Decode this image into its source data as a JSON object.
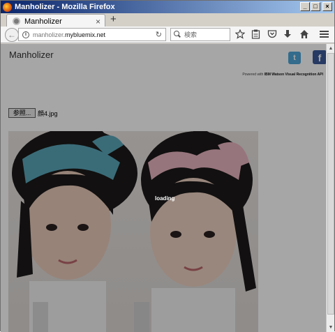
{
  "window": {
    "title": "Manholizer - Mozilla Firefox",
    "controls": {
      "minimize": "_",
      "maximize": "□",
      "close": "×"
    }
  },
  "tabs": [
    {
      "label": "Manholizer",
      "close": "×"
    }
  ],
  "new_tab_label": "+",
  "navbar": {
    "back": "←",
    "url_subdomain": "manholizer.",
    "url_host": "mybluemix.net",
    "reload": "↻",
    "search_placeholder": "検索",
    "icons": [
      "star-icon",
      "reading-list-icon",
      "pocket-icon",
      "download-icon",
      "home-icon",
      "menu-icon"
    ]
  },
  "page": {
    "site_title": "Manholizer",
    "social": {
      "twitter": "t",
      "facebook": "f"
    },
    "powered_prefix": "Powered with",
    "powered_service": "IBM Watson Visual Recognition API",
    "file_button": "参照...",
    "file_name": "顔4.jpg",
    "loading": "loading"
  },
  "colors": {
    "twitter": "#4fa6d8",
    "facebook": "#3b5998",
    "title_bar": "#0a246a"
  }
}
